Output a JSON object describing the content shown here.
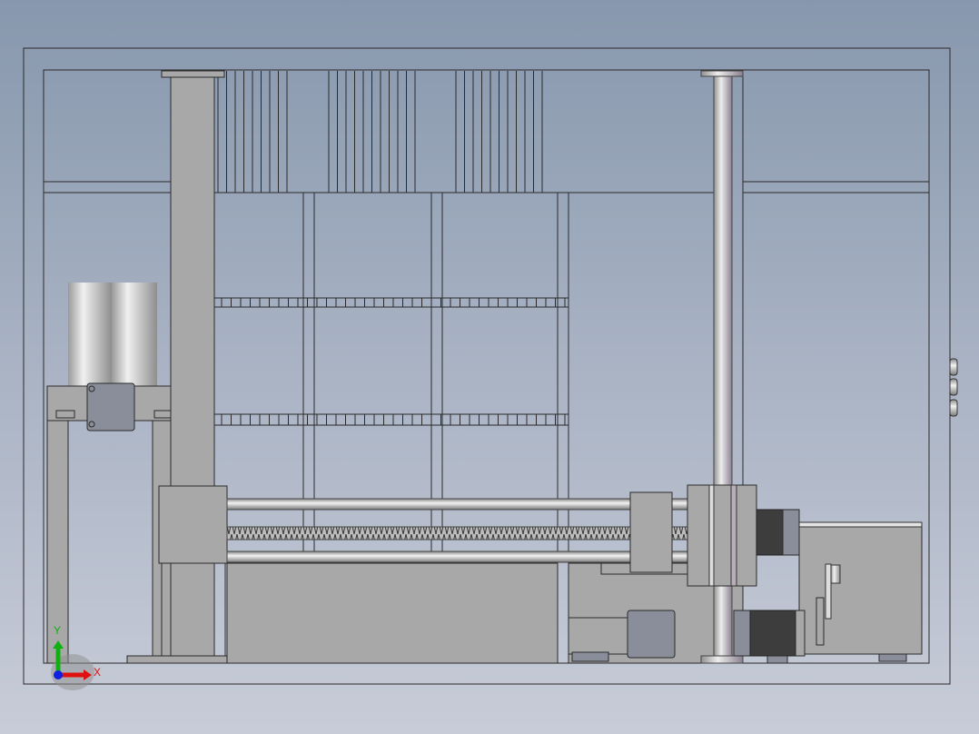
{
  "viewport": {
    "triad": {
      "x_label": "X",
      "y_label": "Y"
    },
    "colors": {
      "x_axis": "#e01010",
      "y_axis": "#10b010",
      "z_axis": "#1020e0",
      "part": "#a8a8a8",
      "motor": "#3d3d3d"
    }
  }
}
